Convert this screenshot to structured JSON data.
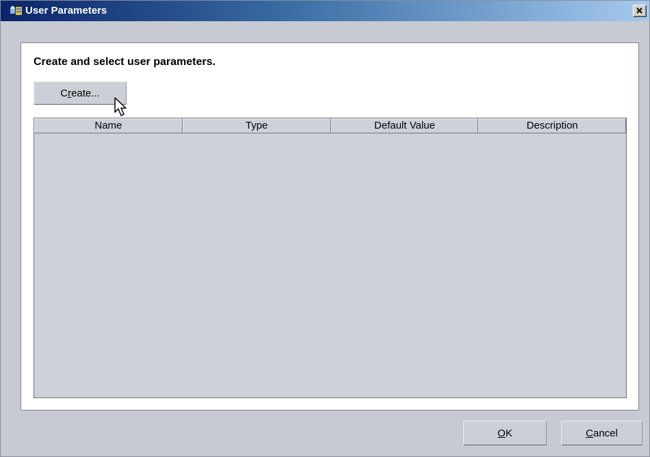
{
  "window": {
    "title": "User Parameters",
    "close_label": "×"
  },
  "content": {
    "heading": "Create and select user parameters.",
    "create_button": {
      "pre": "C",
      "mnemonic": "r",
      "post": "eate..."
    }
  },
  "table": {
    "columns": [
      "Name",
      "Type",
      "Default Value",
      "Description"
    ],
    "rows": []
  },
  "footer": {
    "ok_button": {
      "pre": "",
      "mnemonic": "O",
      "post": "K"
    },
    "cancel_button": {
      "pre": "",
      "mnemonic": "C",
      "post": "ancel"
    }
  }
}
